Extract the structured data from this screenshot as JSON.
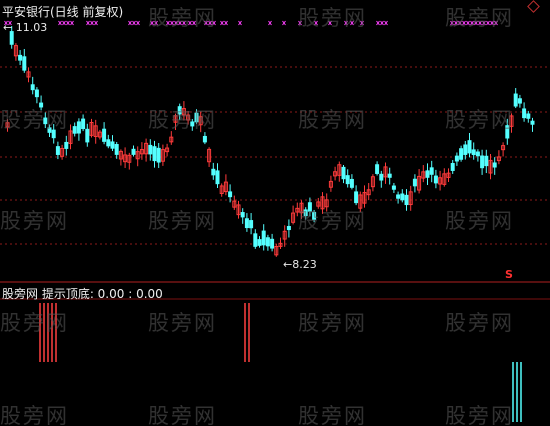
{
  "header": {
    "title": "平安银行(日线 前复权)",
    "high_label": "← 11.03",
    "low_label": "←8.23",
    "signal_marker": "S"
  },
  "indicator": {
    "title": "股旁网  提示顶底: 0.00 : 0.00"
  },
  "watermark": "股旁网",
  "colors": {
    "background": "#000000",
    "up": "#ff3b3b",
    "down": "#54ffff",
    "grid": "#8b1a1a",
    "cross_marker": "#ff40ff"
  }
}
